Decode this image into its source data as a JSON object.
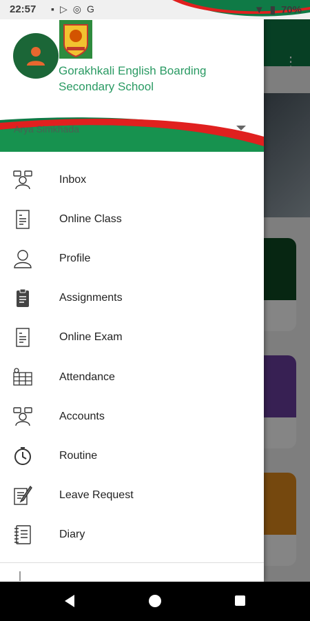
{
  "status_bar": {
    "time": "22:57",
    "battery": "70%"
  },
  "drawer": {
    "school_name": "Gorakhkali English Boarding Secondary School",
    "user_name": "Arya  Simkhada",
    "menu": [
      {
        "label": "Inbox",
        "icon": "inbox-icon"
      },
      {
        "label": "Online Class",
        "icon": "online-class-icon"
      },
      {
        "label": "Profile",
        "icon": "profile-icon"
      },
      {
        "label": "Assignments",
        "icon": "assignments-icon"
      },
      {
        "label": "Online Exam",
        "icon": "online-exam-icon"
      },
      {
        "label": "Attendance",
        "icon": "attendance-icon"
      },
      {
        "label": "Accounts",
        "icon": "accounts-icon"
      },
      {
        "label": "Routine",
        "icon": "routine-icon"
      },
      {
        "label": "Leave Request",
        "icon": "leave-request-icon"
      },
      {
        "label": "Diary",
        "icon": "diary-icon"
      }
    ]
  },
  "colors": {
    "brand_green": "#0f7a46",
    "accent_red": "#e0201f",
    "text_green": "#2a9a63",
    "card_dark_green": "#0e4a24",
    "card_purple": "#6a3fa0",
    "card_orange": "#e08a1c"
  }
}
